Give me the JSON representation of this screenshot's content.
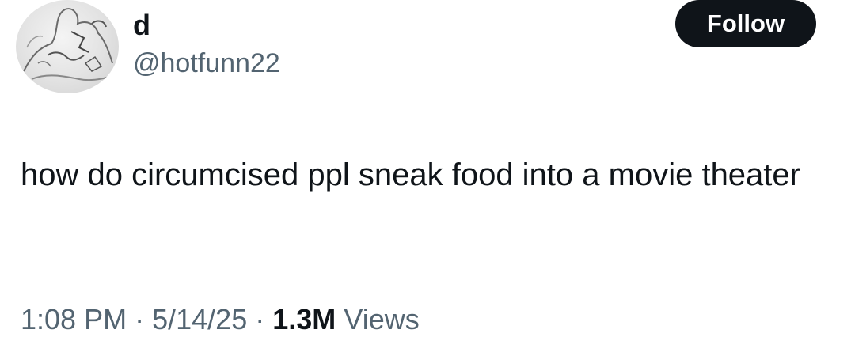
{
  "user": {
    "display_name": "d",
    "handle": "@hotfunn22"
  },
  "follow_label": "Follow",
  "tweet": {
    "text": "how do circumcised ppl sneak food into a movie theater"
  },
  "meta": {
    "time": "1:08 PM",
    "separator": "·",
    "date": "5/14/25",
    "views_count": "1.3M",
    "views_label": "Views"
  }
}
